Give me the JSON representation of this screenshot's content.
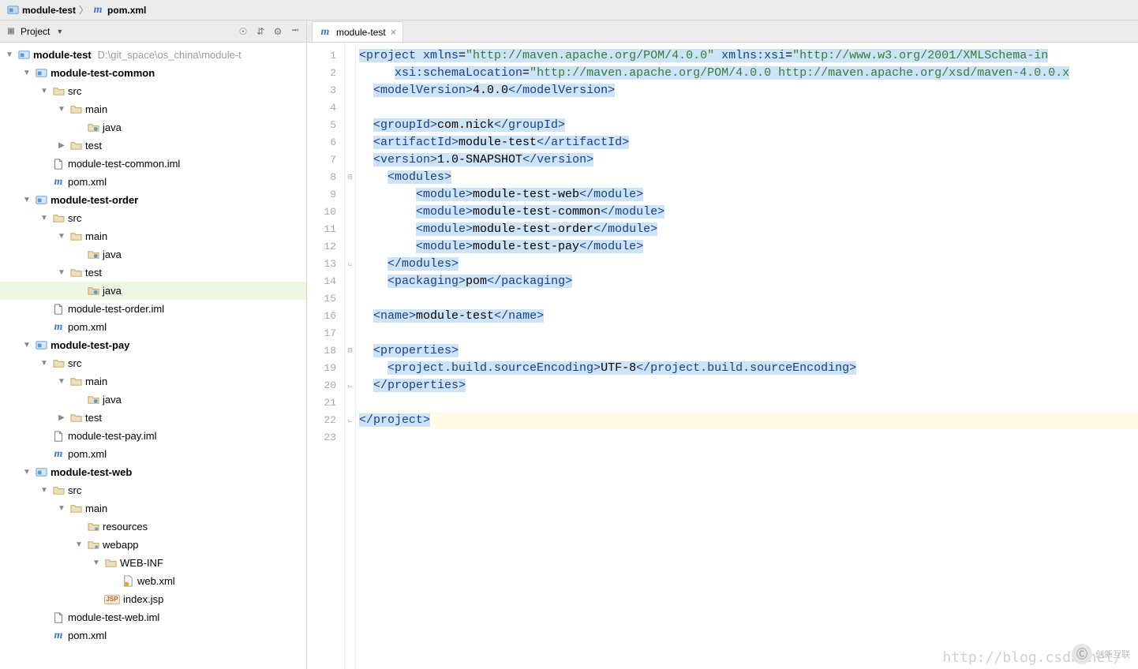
{
  "breadcrumb": [
    {
      "icon": "module",
      "label": "module-test"
    },
    {
      "icon": "m",
      "label": "pom.xml"
    }
  ],
  "sidebar": {
    "title": "Project",
    "actions": [
      "target-icon",
      "collapse-icon",
      "gear-icon",
      "hide-icon"
    ],
    "tree": [
      {
        "d": 0,
        "a": "down",
        "i": "module",
        "l": "module-test",
        "b": true,
        "hint": "D:\\git_space\\os_china\\module-t"
      },
      {
        "d": 1,
        "a": "down",
        "i": "module",
        "l": "module-test-common",
        "b": true
      },
      {
        "d": 2,
        "a": "down",
        "i": "folder",
        "l": "src"
      },
      {
        "d": 3,
        "a": "down",
        "i": "folder",
        "l": "main"
      },
      {
        "d": 4,
        "a": "",
        "i": "pkg",
        "l": "java"
      },
      {
        "d": 3,
        "a": "right",
        "i": "folder",
        "l": "test"
      },
      {
        "d": 2,
        "a": "",
        "i": "file",
        "l": "module-test-common.iml"
      },
      {
        "d": 2,
        "a": "",
        "i": "m",
        "l": "pom.xml"
      },
      {
        "d": 1,
        "a": "down",
        "i": "module",
        "l": "module-test-order",
        "b": true
      },
      {
        "d": 2,
        "a": "down",
        "i": "folder",
        "l": "src"
      },
      {
        "d": 3,
        "a": "down",
        "i": "folder",
        "l": "main"
      },
      {
        "d": 4,
        "a": "",
        "i": "pkg",
        "l": "java"
      },
      {
        "d": 3,
        "a": "down",
        "i": "folder",
        "l": "test"
      },
      {
        "d": 4,
        "a": "",
        "i": "pkg",
        "l": "java",
        "hi": true
      },
      {
        "d": 2,
        "a": "",
        "i": "file",
        "l": "module-test-order.iml"
      },
      {
        "d": 2,
        "a": "",
        "i": "m",
        "l": "pom.xml"
      },
      {
        "d": 1,
        "a": "down",
        "i": "module",
        "l": "module-test-pay",
        "b": true
      },
      {
        "d": 2,
        "a": "down",
        "i": "folder",
        "l": "src"
      },
      {
        "d": 3,
        "a": "down",
        "i": "folder",
        "l": "main"
      },
      {
        "d": 4,
        "a": "",
        "i": "pkg",
        "l": "java"
      },
      {
        "d": 3,
        "a": "right",
        "i": "folder",
        "l": "test"
      },
      {
        "d": 2,
        "a": "",
        "i": "file",
        "l": "module-test-pay.iml"
      },
      {
        "d": 2,
        "a": "",
        "i": "m",
        "l": "pom.xml"
      },
      {
        "d": 1,
        "a": "down",
        "i": "module",
        "l": "module-test-web",
        "b": true
      },
      {
        "d": 2,
        "a": "down",
        "i": "folder",
        "l": "src"
      },
      {
        "d": 3,
        "a": "down",
        "i": "folder",
        "l": "main"
      },
      {
        "d": 4,
        "a": "",
        "i": "folder-spec",
        "l": "resources"
      },
      {
        "d": 4,
        "a": "down",
        "i": "folder-spec",
        "l": "webapp"
      },
      {
        "d": 5,
        "a": "down",
        "i": "folder",
        "l": "WEB-INF"
      },
      {
        "d": 6,
        "a": "",
        "i": "xml",
        "l": "web.xml"
      },
      {
        "d": 5,
        "a": "",
        "i": "jsp",
        "l": "index.jsp"
      },
      {
        "d": 2,
        "a": "",
        "i": "file",
        "l": "module-test-web.iml"
      },
      {
        "d": 2,
        "a": "",
        "i": "m",
        "l": "pom.xml"
      }
    ]
  },
  "editor": {
    "tab": {
      "icon": "m",
      "label": "module-test",
      "closable": true
    },
    "lines": [
      {
        "n": 1,
        "fold": "＜",
        "sel": true,
        "tokens": [
          [
            "tag",
            "<project "
          ],
          [
            "attr",
            "xmlns"
          ],
          [
            "txt",
            "="
          ],
          [
            "val",
            "\"http://maven.apache.org/POM/4.0.0\""
          ],
          [
            "txt",
            " "
          ],
          [
            "attr",
            "xmlns:xsi"
          ],
          [
            "txt",
            "="
          ],
          [
            "val",
            "\"http://www.w3.org/2001/XMLSchema-in"
          ]
        ]
      },
      {
        "n": 2,
        "sel": true,
        "indent": "     ",
        "tokens": [
          [
            "attr",
            "xsi:schemaLocation"
          ],
          [
            "txt",
            "="
          ],
          [
            "val",
            "\"http://maven.apache.org/POM/4.0.0 http://maven.apache.org/xsd/maven-4.0.0.x"
          ]
        ]
      },
      {
        "n": 3,
        "sel": true,
        "indent": "  ",
        "tokens": [
          [
            "tag",
            "<modelVersion>"
          ],
          [
            "txt",
            "4.0.0"
          ],
          [
            "tag",
            "</modelVersion>"
          ]
        ]
      },
      {
        "n": 4,
        "sel": true,
        "indent": "",
        "tokens": []
      },
      {
        "n": 5,
        "sel": true,
        "indent": "  ",
        "tokens": [
          [
            "tag",
            "<groupId>"
          ],
          [
            "txt",
            "com.nick"
          ],
          [
            "tag",
            "</groupId>"
          ]
        ]
      },
      {
        "n": 6,
        "sel": true,
        "indent": "  ",
        "tokens": [
          [
            "tag",
            "<artifactId>"
          ],
          [
            "txt",
            "module-test"
          ],
          [
            "tag",
            "</artifactId>"
          ]
        ]
      },
      {
        "n": 7,
        "sel": true,
        "indent": "  ",
        "tokens": [
          [
            "tag",
            "<version>"
          ],
          [
            "txt",
            "1.0-SNAPSHOT"
          ],
          [
            "tag",
            "</version>"
          ]
        ]
      },
      {
        "n": 8,
        "fold": "⊟",
        "sel": true,
        "indent": "    ",
        "tokens": [
          [
            "tag",
            "<modules>"
          ]
        ]
      },
      {
        "n": 9,
        "sel": true,
        "indent": "        ",
        "tokens": [
          [
            "tag",
            "<module>"
          ],
          [
            "txt",
            "module-test-web"
          ],
          [
            "tag",
            "</module>"
          ]
        ]
      },
      {
        "n": 10,
        "sel": true,
        "indent": "        ",
        "tokens": [
          [
            "tag",
            "<module>"
          ],
          [
            "txt",
            "module-test-common"
          ],
          [
            "tag",
            "</module>"
          ]
        ]
      },
      {
        "n": 11,
        "sel": true,
        "indent": "        ",
        "tokens": [
          [
            "tag",
            "<module>"
          ],
          [
            "txt",
            "module-test-order"
          ],
          [
            "tag",
            "</module>"
          ]
        ]
      },
      {
        "n": 12,
        "sel": true,
        "indent": "        ",
        "tokens": [
          [
            "tag",
            "<module>"
          ],
          [
            "txt",
            "module-test-pay"
          ],
          [
            "tag",
            "</module>"
          ]
        ]
      },
      {
        "n": 13,
        "fold": "⊦",
        "sel": true,
        "indent": "    ",
        "tokens": [
          [
            "tag",
            "</modules>"
          ]
        ]
      },
      {
        "n": 14,
        "sel": true,
        "indent": "    ",
        "tokens": [
          [
            "tag",
            "<packaging>"
          ],
          [
            "txt",
            "pom"
          ],
          [
            "tag",
            "</packaging>"
          ]
        ]
      },
      {
        "n": 15,
        "sel": true,
        "indent": "",
        "tokens": []
      },
      {
        "n": 16,
        "sel": true,
        "indent": "  ",
        "tokens": [
          [
            "tag",
            "<name>"
          ],
          [
            "txt",
            "module-test"
          ],
          [
            "tag",
            "</name>"
          ]
        ]
      },
      {
        "n": 17,
        "sel": true,
        "indent": "",
        "tokens": []
      },
      {
        "n": 18,
        "fold": "⊟",
        "sel": true,
        "indent": "  ",
        "tokens": [
          [
            "tag",
            "<properties>"
          ]
        ]
      },
      {
        "n": 19,
        "sel": true,
        "indent": "    ",
        "tokens": [
          [
            "tag",
            "<project.build.sourceEncoding>"
          ],
          [
            "txt",
            "UTF-8"
          ],
          [
            "tag",
            "</project.build.sourceEncoding>"
          ]
        ]
      },
      {
        "n": 20,
        "fold": "⊦",
        "sel": true,
        "indent": "  ",
        "tokens": [
          [
            "tag",
            "</properties>"
          ]
        ]
      },
      {
        "n": 21,
        "sel": true,
        "indent": "",
        "tokens": []
      },
      {
        "n": 22,
        "fold": "⊦",
        "sel": true,
        "current": true,
        "indent": "",
        "tokens": [
          [
            "tag",
            "</project>"
          ]
        ]
      },
      {
        "n": 23,
        "indent": "",
        "tokens": []
      }
    ]
  },
  "watermark": "http://blog.csdn.net/",
  "wm_brand": "创新互联"
}
